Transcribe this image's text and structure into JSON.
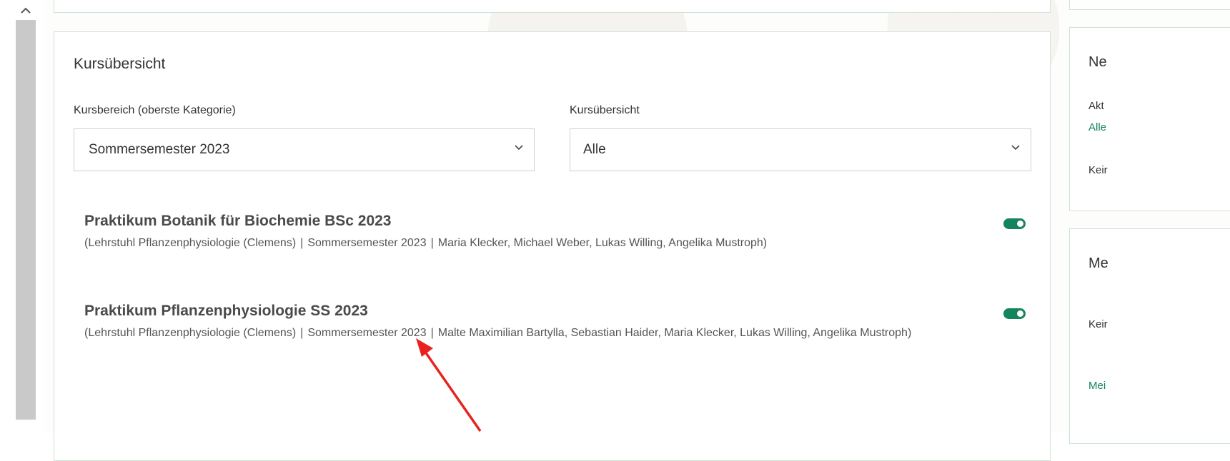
{
  "scrollbar": {
    "up_icon": "chevron-up-icon"
  },
  "main": {
    "title": "Kursübersicht",
    "category_label": "Kursbereich (oberste Kategorie)",
    "category_value": "Sommersemester 2023",
    "overview_label": "Kursübersicht",
    "overview_value": "Alle"
  },
  "courses": [
    {
      "title": "Praktikum Botanik für Biochemie BSc 2023",
      "department": "(Lehrstuhl Pflanzenphysiologie (Clemens)",
      "semester": "Sommersemester 2023",
      "teachers": "Maria Klecker, Michael Weber, Lukas Willing, Angelika Mustroph)",
      "toggle_on": true
    },
    {
      "title": "Praktikum Pflanzenphysiologie SS 2023",
      "department": "(Lehrstuhl Pflanzenphysiologie (Clemens)",
      "semester": "Sommersemester 2023",
      "teachers": "Malte Maximilian Bartylla, Sebastian Haider, Maria Klecker, Lukas Willing, Angelika Mustroph)",
      "toggle_on": true
    }
  ],
  "right_panel": {
    "card1_heading": "Ne",
    "card1_line1": "Akt",
    "card1_link": "Alle",
    "card1_line2": "Keir",
    "card2_heading": "Me",
    "card2_line1": "Keir",
    "card2_link": "Mei"
  },
  "colors": {
    "accent": "#14845c",
    "border": "#cfe3d8",
    "annotation_arrow": "#e8231f"
  }
}
